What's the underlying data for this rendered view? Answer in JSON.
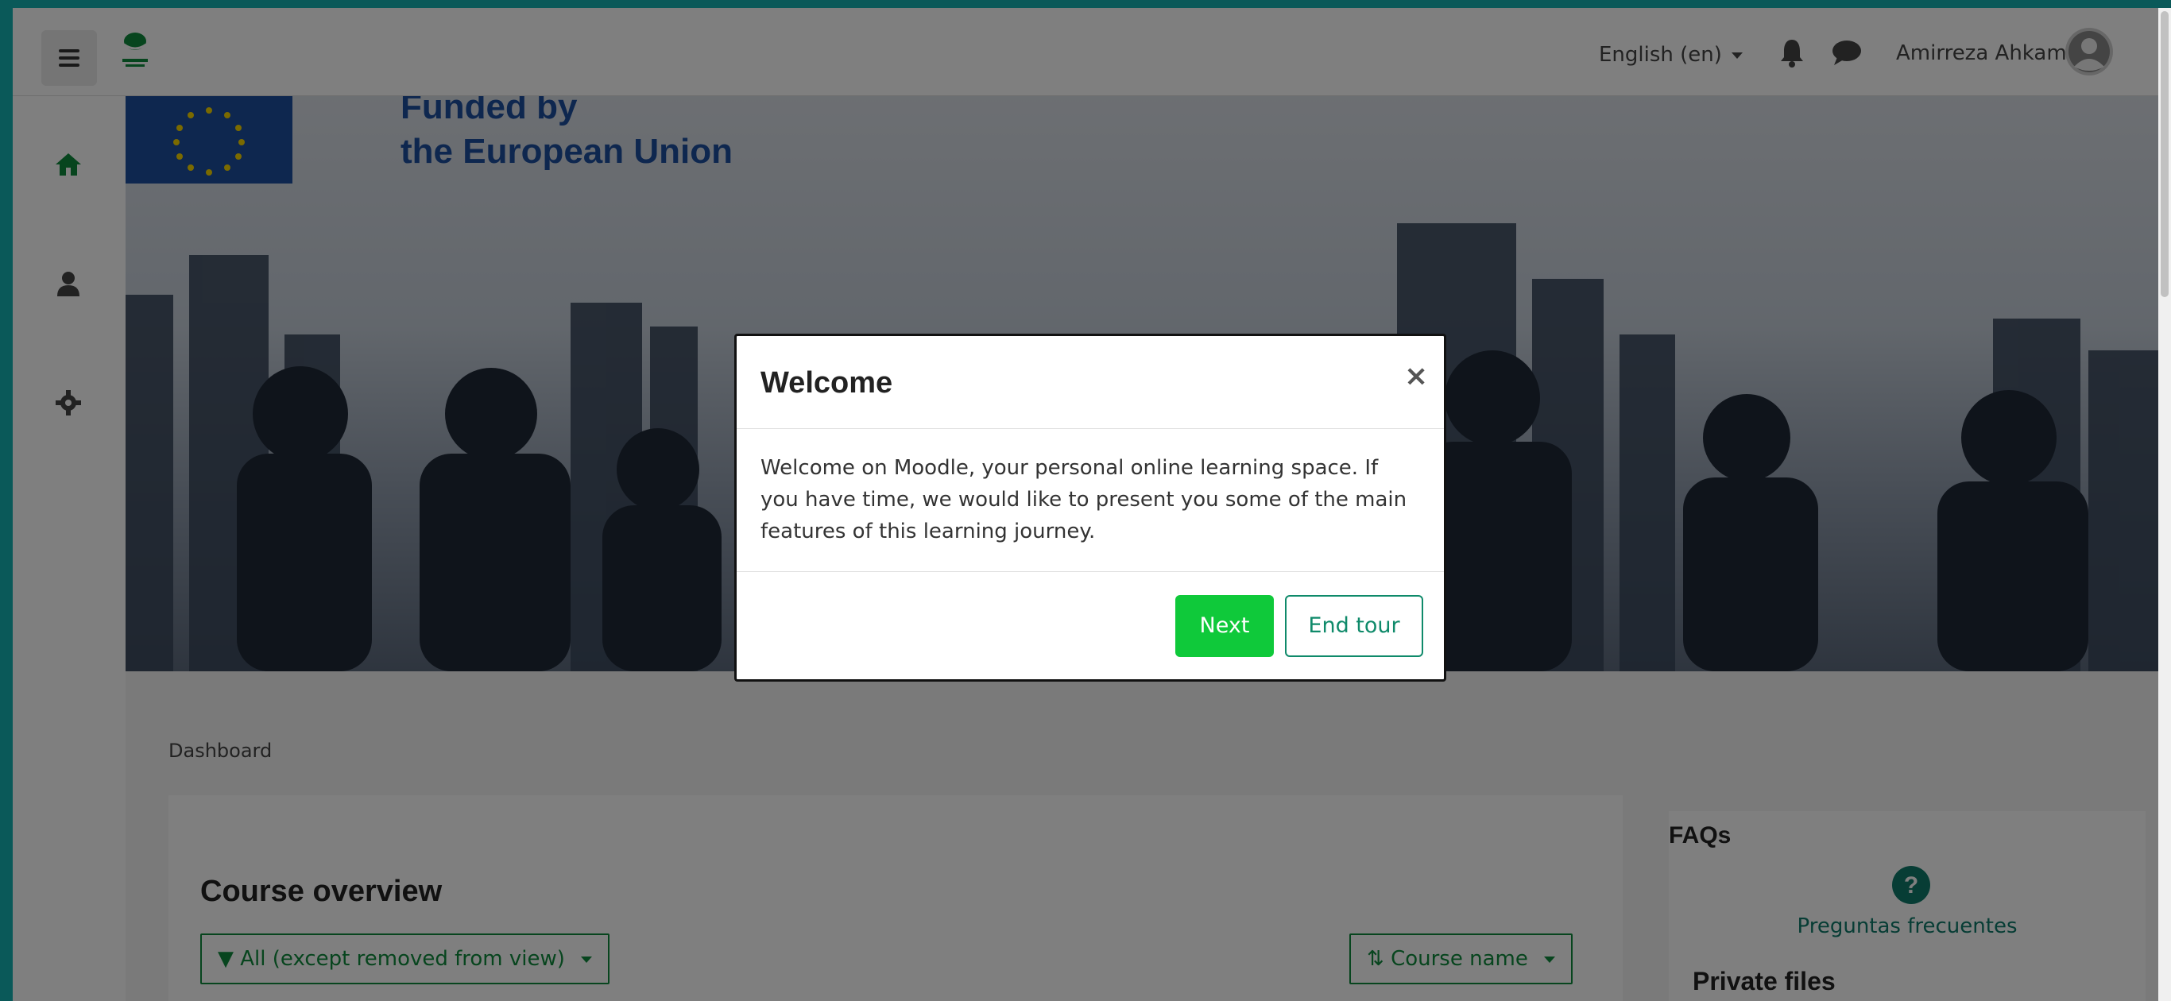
{
  "navbar": {
    "language": "English (en)",
    "username": "Amirreza Ahkami",
    "icons": [
      "menu-icon",
      "logo",
      "bell-icon",
      "chat-icon",
      "avatar-icon"
    ]
  },
  "sidebar": {
    "items": [
      {
        "icon": "home-icon",
        "active": true
      },
      {
        "icon": "user-icon",
        "active": false
      },
      {
        "icon": "gear-icon",
        "active": false
      }
    ]
  },
  "hero": {
    "funding_line1": "Funded by",
    "funding_line2": "the European Union"
  },
  "breadcrumb": "Dashboard",
  "course_overview": {
    "title": "Course overview",
    "filter_label": "All (except removed from view)",
    "sort_label": "Course name"
  },
  "faq_block": {
    "heading": "FAQs",
    "link": "Preguntas frecuentes"
  },
  "private_files": {
    "heading": "Private files"
  },
  "modal": {
    "title": "Welcome",
    "close": "×",
    "body": "Welcome on Moodle, your personal online learning space. If you have time, we would like to present you some of the main features of this learning journey.",
    "next_label": "Next",
    "end_label": "End tour"
  },
  "colors": {
    "accent_green": "#0f8a3c",
    "next_button": "#0fc93a",
    "frame_border": "#14b3b3"
  }
}
